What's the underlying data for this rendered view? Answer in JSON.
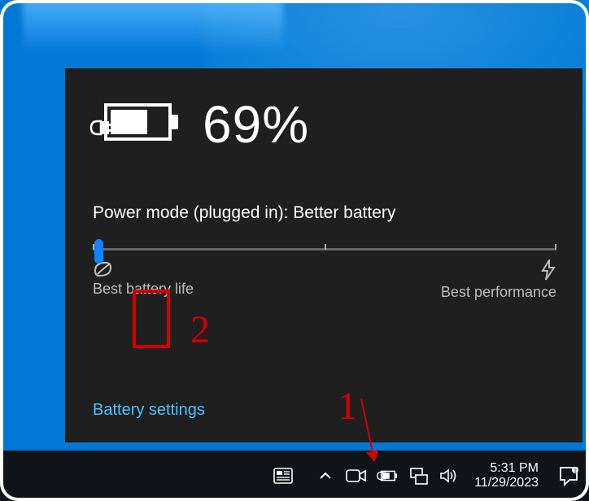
{
  "battery": {
    "percent_label": "69%",
    "mode_label": "Power mode (plugged in): Better battery",
    "slider": {
      "left_label": "Best battery life",
      "right_label": "Best performance"
    },
    "settings_link": "Battery settings"
  },
  "taskbar": {
    "time": "5:31 PM",
    "date": "11/29/2023"
  },
  "annotations": {
    "label1": "1",
    "label2": "2"
  }
}
